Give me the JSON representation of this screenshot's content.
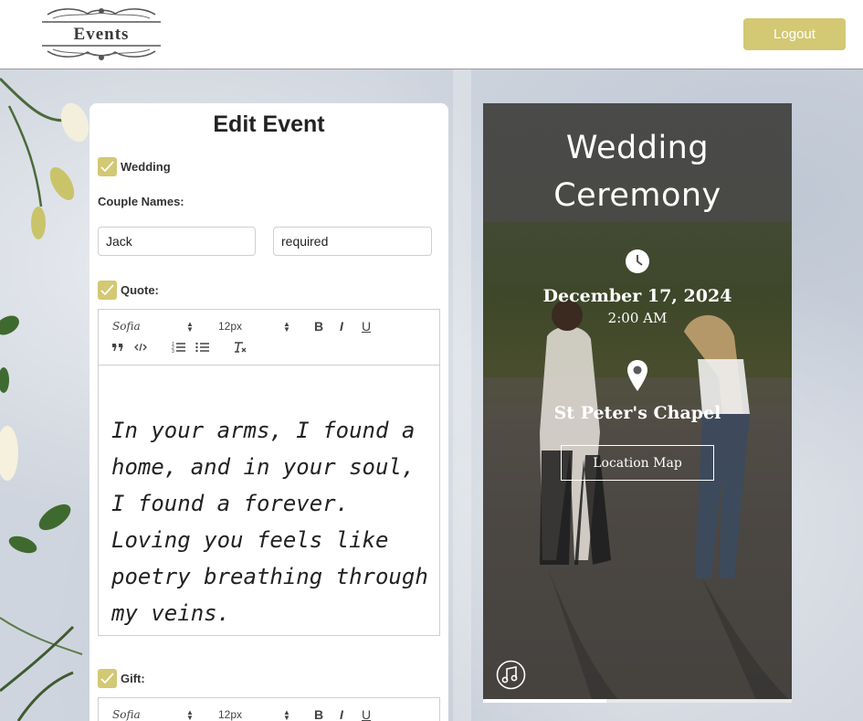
{
  "header": {
    "logo_text": "Events",
    "logout_label": "Logout"
  },
  "editor_panel": {
    "title": "Edit Event",
    "wedding_checkbox": {
      "label": "Wedding",
      "checked": true
    },
    "couple_names_label": "Couple Names:",
    "name1": {
      "value": "Jack"
    },
    "name2": {
      "value": "required"
    },
    "quote_checkbox": {
      "label": "Quote:",
      "checked": true
    },
    "quote_toolbar": {
      "font": "Sofia",
      "size": "12px",
      "bold": "B",
      "italic": "I",
      "underline": "U"
    },
    "quote_text": "In your arms, I found a home, and in your soul, I found a forever. Loving you feels like poetry breathing through my veins.",
    "gift_checkbox": {
      "label": "Gift:",
      "checked": true
    },
    "gift_toolbar": {
      "font": "Sofia",
      "size": "12px",
      "bold": "B",
      "italic": "I",
      "underline": "U"
    }
  },
  "preview": {
    "title_line1": "Wedding",
    "title_line2": "Ceremony",
    "date": "December 17, 2024",
    "time": "2:00 AM",
    "venue": "St Peter's Chapel",
    "map_button": "Location Map",
    "progress_fraction": 0.4
  },
  "icons": {
    "clock": "clock-icon",
    "location": "map-pin-icon",
    "music": "music-note-icon"
  },
  "colors": {
    "accent": "#d3c874",
    "preview_text": "#ffffff"
  }
}
